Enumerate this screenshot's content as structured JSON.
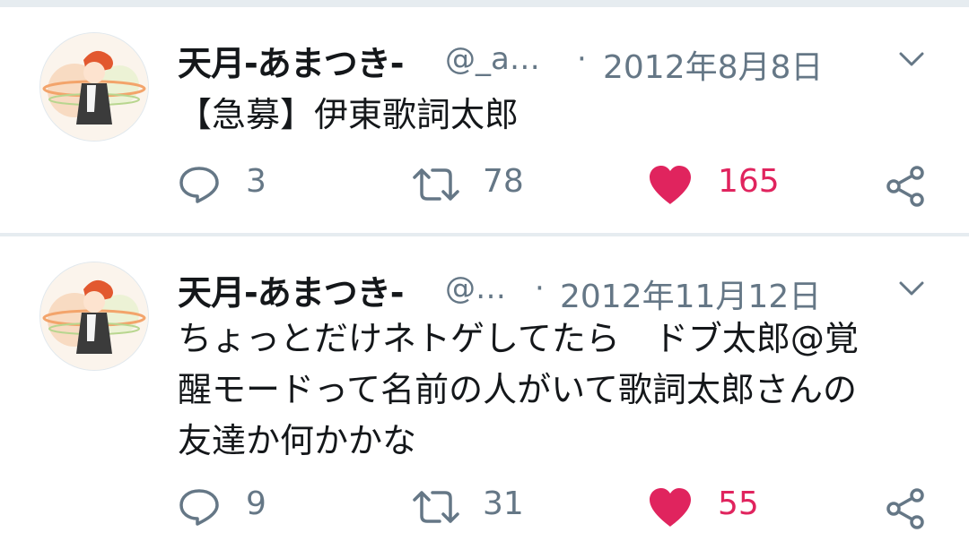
{
  "tweets": [
    {
      "name": "天月-あまつき-",
      "handle": "@_a…",
      "separator": "·",
      "date": "2012年8月8日",
      "text_lines": [
        "【急募】伊東歌詞太郎"
      ],
      "replies": "3",
      "retweets": "78",
      "likes": "165"
    },
    {
      "name": "天月-あまつき-",
      "handle": "@…",
      "separator": "·",
      "date": "2012年11月12日",
      "text_lines": [
        "ちょっとだけネトゲしてたら　ドブ太郎@覚",
        "醒モードって名前の人がいて歌詞太郎さんの",
        "友達か何かかな"
      ],
      "replies": "9",
      "retweets": "31",
      "likes": "55"
    }
  ],
  "icons": {
    "reply": "speech-bubble-icon",
    "retweet": "retweet-arrows-icon",
    "like": "heart-icon",
    "share": "share-icon",
    "menu": "chevron-down-icon"
  },
  "colors": {
    "muted": "#657786",
    "like": "#e0245e",
    "divider": "#e6ecf0"
  }
}
